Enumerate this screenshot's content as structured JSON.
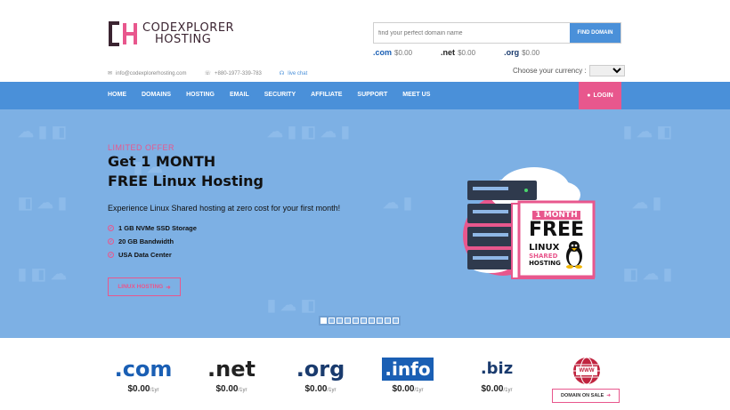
{
  "brand": {
    "line1": "CODEXPLORER",
    "line2": "HOSTING",
    "mark": "CH"
  },
  "search": {
    "placeholder": "find your perfect domain name",
    "button": "FIND DOMAIN"
  },
  "top_tlds": [
    {
      "ext": ".com",
      "price": "$0.00"
    },
    {
      "ext": ".net",
      "price": "$0.00"
    },
    {
      "ext": ".org",
      "price": "$0.00"
    }
  ],
  "currency": {
    "label": "Choose your currency :",
    "selected": ""
  },
  "contact": {
    "email": "info@codexplorerhosting.com",
    "phone": "+880-1977-339-783",
    "chat": "live chat"
  },
  "nav": {
    "items": [
      "HOME",
      "DOMAINS",
      "HOSTING",
      "EMAIL",
      "SECURITY",
      "AFFILIATE",
      "SUPPORT",
      "MEET US"
    ],
    "login": "LOGIN"
  },
  "hero": {
    "offer": "LIMITED OFFER",
    "title1": "Get 1 MONTH",
    "title2": "FREE Linux Hosting",
    "desc": "Experience Linux Shared hosting at zero cost for your first month!",
    "features": [
      "1 GB NVMe SSD Storage",
      "20 GB Bandwidth",
      "USA Data Center"
    ],
    "button": "LINUX HOSTING",
    "badge": {
      "line1": "1 MONTH",
      "line2": "FREE",
      "line3": "LINUX",
      "line4": "SHARED",
      "line5": "HOSTING"
    },
    "slides": 10,
    "active_slide": 0
  },
  "domains": [
    {
      "ext": ".com",
      "price": "$0.00",
      "period": "/1yr",
      "color": "#1a5fb4"
    },
    {
      "ext": ".net",
      "price": "$0.00",
      "period": "/1yr",
      "color": "#222222"
    },
    {
      "ext": ".org",
      "price": "$0.00",
      "period": "/1yr",
      "color": "#1a3b6e"
    },
    {
      "ext": ".info",
      "price": "$0.00",
      "period": "/1yr",
      "color": "#1a5fb4"
    },
    {
      "ext": ".biz",
      "price": "$0.00",
      "period": "/1yr",
      "color": "#1a3b6e"
    }
  ],
  "sale": {
    "label": "DOMAIN ON SALE",
    "badge": "WWW"
  },
  "colors": {
    "primary": "#4a90d9",
    "accent": "#e8578d",
    "hero_bg": "#7db0e4"
  }
}
